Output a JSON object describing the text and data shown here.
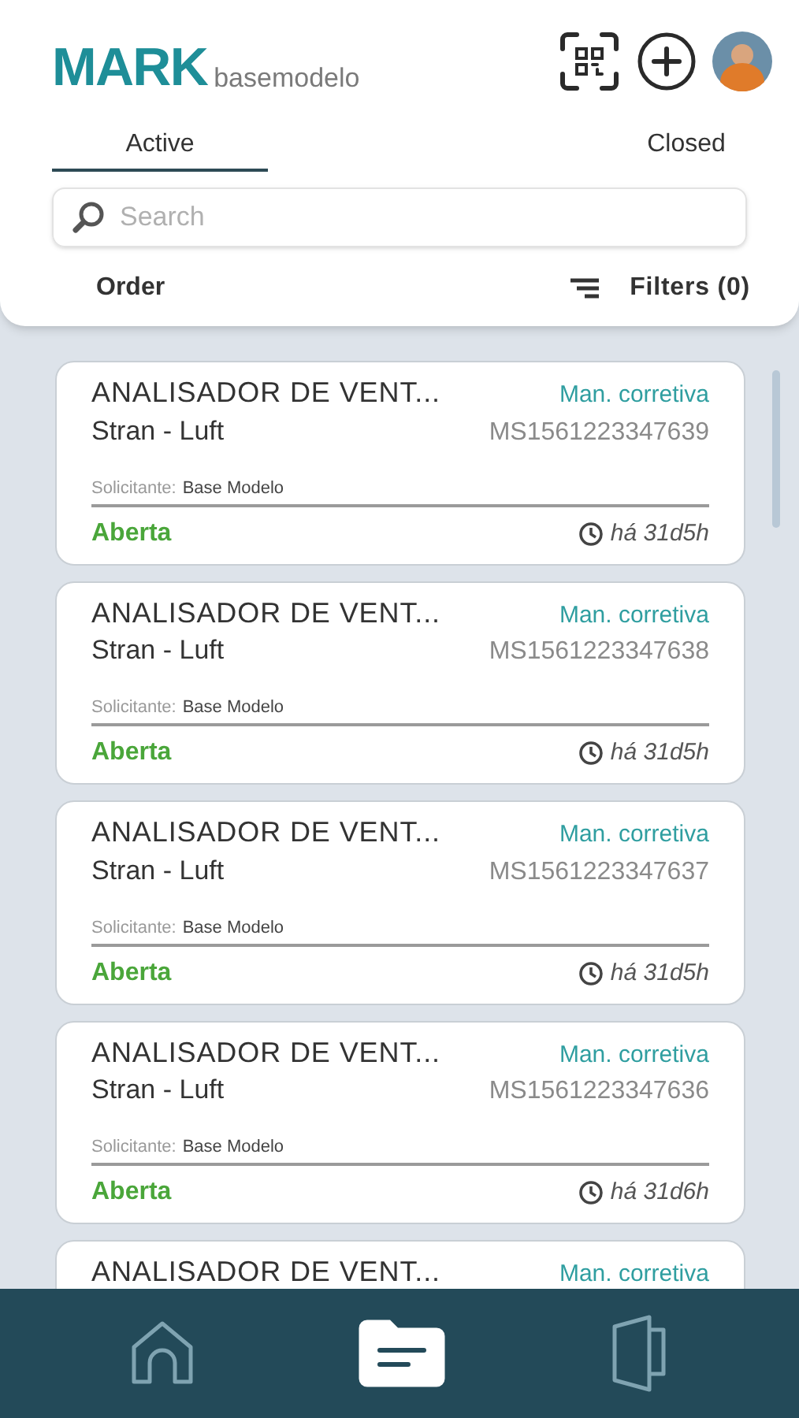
{
  "header": {
    "logo": "MARK",
    "workspace": "basemodelo"
  },
  "tabs": [
    {
      "label": "Active",
      "selected": true
    },
    {
      "label": "Closed",
      "selected": false
    }
  ],
  "search": {
    "placeholder": "Search"
  },
  "order": "Order",
  "filters": "Filters (0)",
  "orders": [
    {
      "title": "ANALISADOR DE VENT...",
      "type": "Man. corretiva",
      "model": "Stran - Luft",
      "code": "MS1561223347639",
      "requester_label": "Solicitante:",
      "requester": "Base Modelo",
      "status": "Aberta",
      "age": "há 31d5h"
    },
    {
      "title": "ANALISADOR DE VENT...",
      "type": "Man. corretiva",
      "model": "Stran - Luft",
      "code": "MS1561223347638",
      "requester_label": "Solicitante:",
      "requester": "Base Modelo",
      "status": "Aberta",
      "age": "há 31d5h"
    },
    {
      "title": "ANALISADOR DE VENT...",
      "type": "Man. corretiva",
      "model": "Stran - Luft",
      "code": "MS1561223347637",
      "requester_label": "Solicitante:",
      "requester": "Base Modelo",
      "status": "Aberta",
      "age": "há 31d5h"
    },
    {
      "title": "ANALISADOR DE VENT...",
      "type": "Man. corretiva",
      "model": "Stran - Luft",
      "code": "MS1561223347636",
      "requester_label": "Solicitante:",
      "requester": "Base Modelo",
      "status": "Aberta",
      "age": "há 31d6h"
    },
    {
      "title": "ANALISADOR DE VENT...",
      "type": "Man. corretiva"
    }
  ],
  "nav": [
    {
      "kind": "home",
      "selected": false
    },
    {
      "kind": "orders",
      "selected": true
    },
    {
      "kind": "exit",
      "selected": false
    }
  ]
}
